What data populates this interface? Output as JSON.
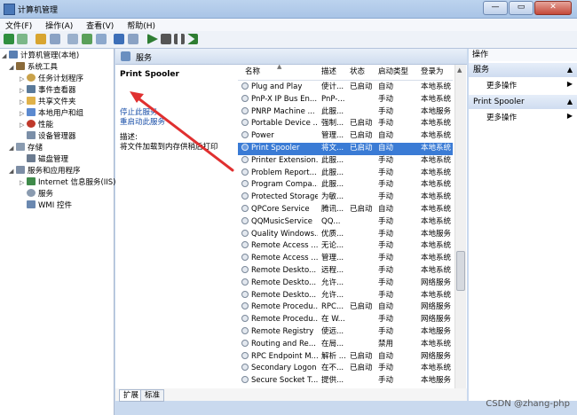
{
  "window": {
    "title": "计算机管理",
    "min": "—",
    "max": "▭",
    "close": "✕"
  },
  "menu": [
    "文件(F)",
    "操作(A)",
    "查看(V)",
    "帮助(H)"
  ],
  "tree": [
    {
      "label": "计算机管理(本地)",
      "level": 0,
      "icon": "computer-icon",
      "expander": "◢"
    },
    {
      "label": "系统工具",
      "level": 1,
      "icon": "tools-icon",
      "expander": "◢"
    },
    {
      "label": "任务计划程序",
      "level": 2,
      "icon": "clock-icon",
      "expander": "▷"
    },
    {
      "label": "事件查看器",
      "level": 2,
      "icon": "event-viewer-icon",
      "expander": "▷"
    },
    {
      "label": "共享文件夹",
      "level": 2,
      "icon": "folder-icon",
      "expander": "▷"
    },
    {
      "label": "本地用户和组",
      "level": 2,
      "icon": "users-icon",
      "expander": "▷"
    },
    {
      "label": "性能",
      "level": 2,
      "icon": "performance-icon",
      "expander": "▷"
    },
    {
      "label": "设备管理器",
      "level": 2,
      "icon": "device-manager-icon",
      "expander": ""
    },
    {
      "label": "存储",
      "level": 1,
      "icon": "storage-icon",
      "expander": "◢"
    },
    {
      "label": "磁盘管理",
      "level": 2,
      "icon": "disk-icon",
      "expander": ""
    },
    {
      "label": "服务和应用程序",
      "level": 1,
      "icon": "services-apps-icon",
      "expander": "◢"
    },
    {
      "label": "Internet 信息服务(IIS)管",
      "level": 2,
      "icon": "iis-icon",
      "expander": "▷"
    },
    {
      "label": "服务",
      "level": 2,
      "icon": "services-icon",
      "expander": ""
    },
    {
      "label": "WMI 控件",
      "level": 2,
      "icon": "wmi-icon",
      "expander": ""
    }
  ],
  "center": {
    "header": "服务",
    "selected_service": "Print Spooler",
    "link_stop": "停止此服务",
    "link_restart": "重启动此服务",
    "desc_label": "描述:",
    "desc_text": "将文件加载到内存供稍后打印"
  },
  "columns": [
    "名称",
    "描述",
    "状态",
    "启动类型",
    "登录为"
  ],
  "rows": [
    [
      "Plug and Play",
      "使计...",
      "已启动",
      "自动",
      "本地系统"
    ],
    [
      "PnP-X IP Bus En...",
      "PnP-...",
      "",
      "手动",
      "本地系统"
    ],
    [
      "PNRP Machine ...",
      "此服...",
      "",
      "手动",
      "本地服务"
    ],
    [
      "Portable Device ...",
      "强制...",
      "已启动",
      "手动",
      "本地系统"
    ],
    [
      "Power",
      "管理...",
      "已启动",
      "自动",
      "本地系统"
    ],
    [
      "Print Spooler",
      "将文...",
      "已启动",
      "自动",
      "本地系统"
    ],
    [
      "Printer Extension...",
      "此服...",
      "",
      "手动",
      "本地系统"
    ],
    [
      "Problem Report...",
      "此服...",
      "",
      "手动",
      "本地系统"
    ],
    [
      "Program Compa...",
      "此服...",
      "",
      "手动",
      "本地系统"
    ],
    [
      "Protected Storage",
      "为敏...",
      "",
      "手动",
      "本地系统"
    ],
    [
      "QPCore Service",
      "腾讯...",
      "已启动",
      "自动",
      "本地系统"
    ],
    [
      "QQMusicService",
      "QQ...",
      "",
      "手动",
      "本地系统"
    ],
    [
      "Quality Windows...",
      "优质...",
      "",
      "手动",
      "本地服务"
    ],
    [
      "Remote Access ...",
      "无论...",
      "",
      "手动",
      "本地系统"
    ],
    [
      "Remote Access ...",
      "管理...",
      "",
      "手动",
      "本地系统"
    ],
    [
      "Remote Deskto...",
      "远程...",
      "",
      "手动",
      "本地系统"
    ],
    [
      "Remote Deskto...",
      "允许...",
      "",
      "手动",
      "网络服务"
    ],
    [
      "Remote Deskto...",
      "允许...",
      "",
      "手动",
      "本地系统"
    ],
    [
      "Remote Procedu...",
      "RPC...",
      "已启动",
      "自动",
      "网络服务"
    ],
    [
      "Remote Procedu...",
      "在 W...",
      "",
      "手动",
      "网络服务"
    ],
    [
      "Remote Registry",
      "使远...",
      "",
      "手动",
      "本地服务"
    ],
    [
      "Routing and Re...",
      "在局...",
      "",
      "禁用",
      "本地系统"
    ],
    [
      "RPC Endpoint M...",
      "解析 ...",
      "已启动",
      "自动",
      "网络服务"
    ],
    [
      "Secondary Logon",
      "在不...",
      "已启动",
      "手动",
      "本地系统"
    ],
    [
      "Secure Socket T...",
      "提供...",
      "",
      "手动",
      "本地服务"
    ]
  ],
  "selected_row": 5,
  "tabs": [
    "扩展",
    "标准"
  ],
  "actions": {
    "title": "操作",
    "sections": [
      {
        "label": "服务",
        "item": "更多操作"
      },
      {
        "label": "Print Spooler",
        "item": "更多操作"
      }
    ]
  },
  "watermark": "CSDN @zhang-php",
  "colors": {
    "selection": "#3a7bd5",
    "link": "#1a4fa8",
    "annotation_arrow": "#e03030"
  }
}
